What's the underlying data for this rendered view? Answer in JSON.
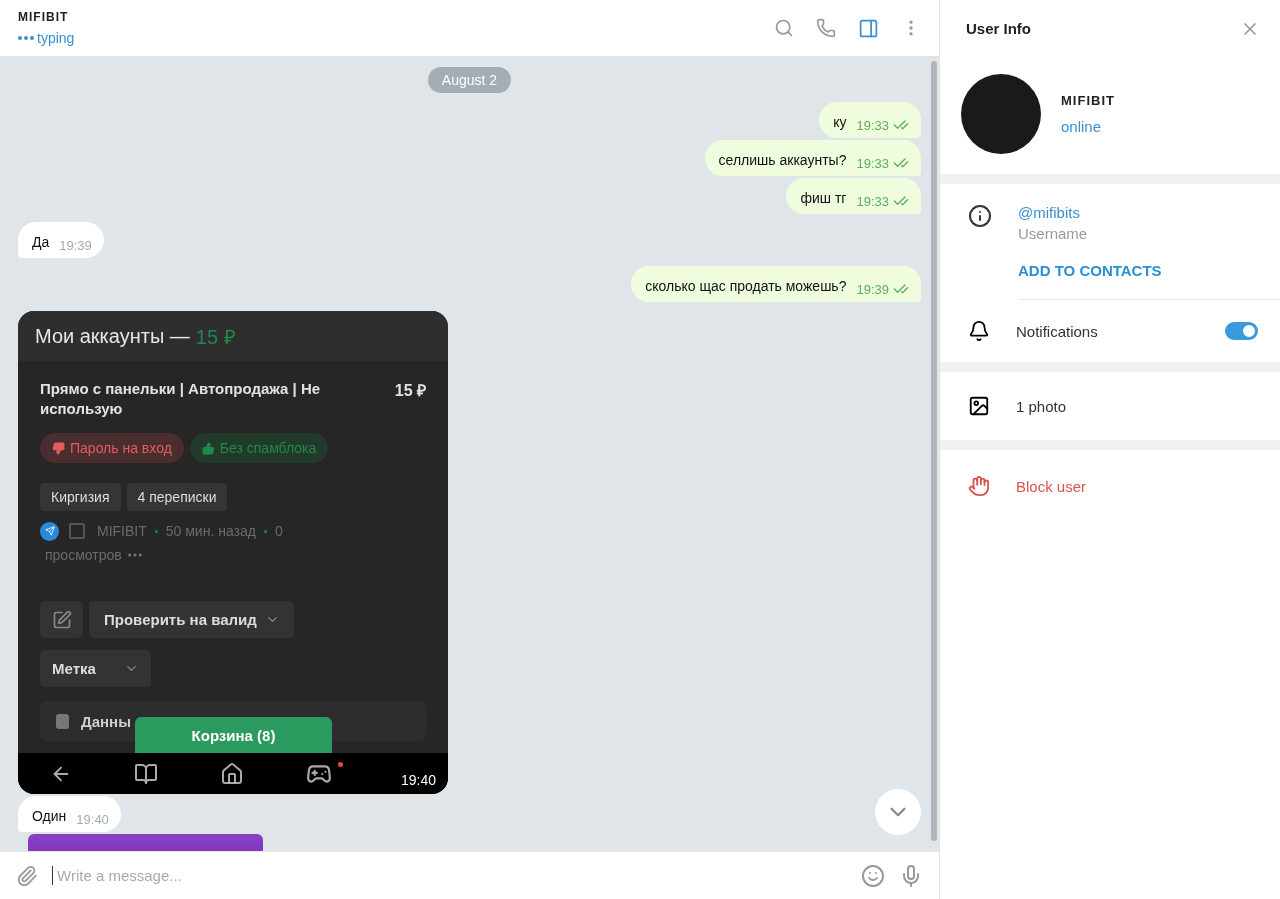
{
  "header": {
    "name": "MIFIBIT",
    "status": "typing",
    "info_panel_open": true
  },
  "chat": {
    "date": "August 2",
    "messages": [
      {
        "kind": "text",
        "outgoing": true,
        "text": "ку",
        "time": "19:33",
        "read": true
      },
      {
        "kind": "text",
        "outgoing": true,
        "text": "селлишь аккаунты?",
        "time": "19:33",
        "read": true
      },
      {
        "kind": "text",
        "outgoing": true,
        "text": "фиш тг",
        "time": "19:33",
        "read": true
      },
      {
        "kind": "text",
        "outgoing": false,
        "text": "Да",
        "time": "19:39"
      },
      {
        "kind": "text",
        "outgoing": true,
        "text": "сколько щас продать можешь?",
        "time": "19:39",
        "read": true
      },
      {
        "kind": "screenshot",
        "outgoing": false,
        "time": "19:40",
        "screenshot": {
          "title": "Мои аккаунты —",
          "price": "15 ₽",
          "listing_title": "Прямо с панельки | Автопродажа | Не использую",
          "listing_price": "15 ₽",
          "badges": [
            {
              "kind": "bad",
              "text": "Пароль на вход"
            },
            {
              "kind": "good",
              "text": "Без спамблока"
            }
          ],
          "tags": [
            "Киргизия",
            "4 переписки"
          ],
          "checked": false,
          "seller": "MIFIBIT",
          "age": "50 мин. назад",
          "views": "0",
          "views_label": "просмотров",
          "select": "Проверить на валид",
          "label": "Метка",
          "data": "Данны",
          "cart": "Корзина (8)"
        }
      },
      {
        "kind": "text",
        "outgoing": false,
        "text": "Один",
        "time": "19:40"
      },
      {
        "kind": "sticker",
        "outgoing": false
      }
    ]
  },
  "composer": {
    "placeholder": "Write a message..."
  },
  "info": {
    "title": "User Info",
    "name": "MIFIBIT",
    "status": "online",
    "username": "@mifibits",
    "username_label": "Username",
    "add_contact": "ADD TO CONTACTS",
    "notifications_label": "Notifications",
    "notifications_on": true,
    "photos": "1 photo",
    "block": "Block user"
  }
}
